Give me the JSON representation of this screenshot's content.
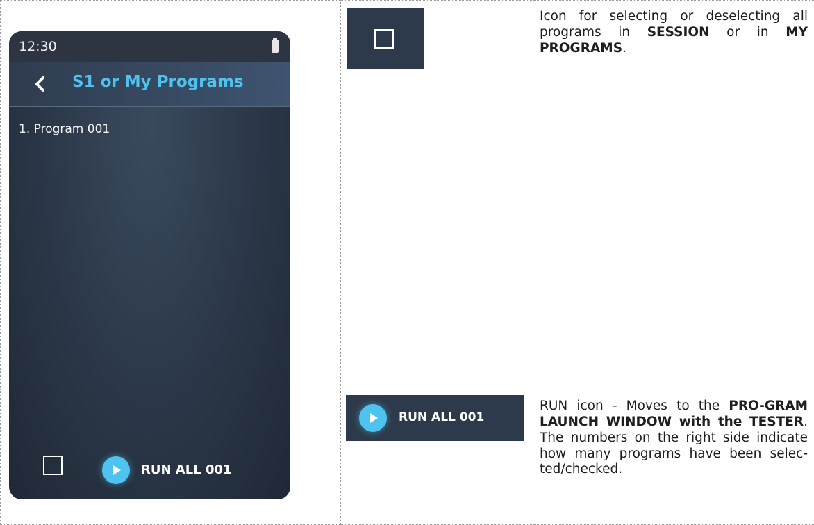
{
  "phone": {
    "status_time": "12:30",
    "header_title": "S1 or My Programs",
    "list_items": [
      "1. Program 001"
    ],
    "run_label": "RUN ALL  001"
  },
  "sample_run_label": "RUN ALL  001",
  "row1_desc": {
    "t1": "Icon for selecting or deselecting all programs in ",
    "b1": "SESSION",
    "t2": " or in ",
    "b2": "MY PROGRAMS",
    "t3": "."
  },
  "row2_desc": {
    "t1": "RUN icon - Moves to the ",
    "b1": "PRO-GRAM LAUNCH WINDOW with the TESTER",
    "t2": ". The numbers on the right side indicate how many programs have been selec-ted/checked."
  },
  "colors": {
    "accent": "#4fc3f0",
    "panel_bg": "#2d3a4b"
  }
}
